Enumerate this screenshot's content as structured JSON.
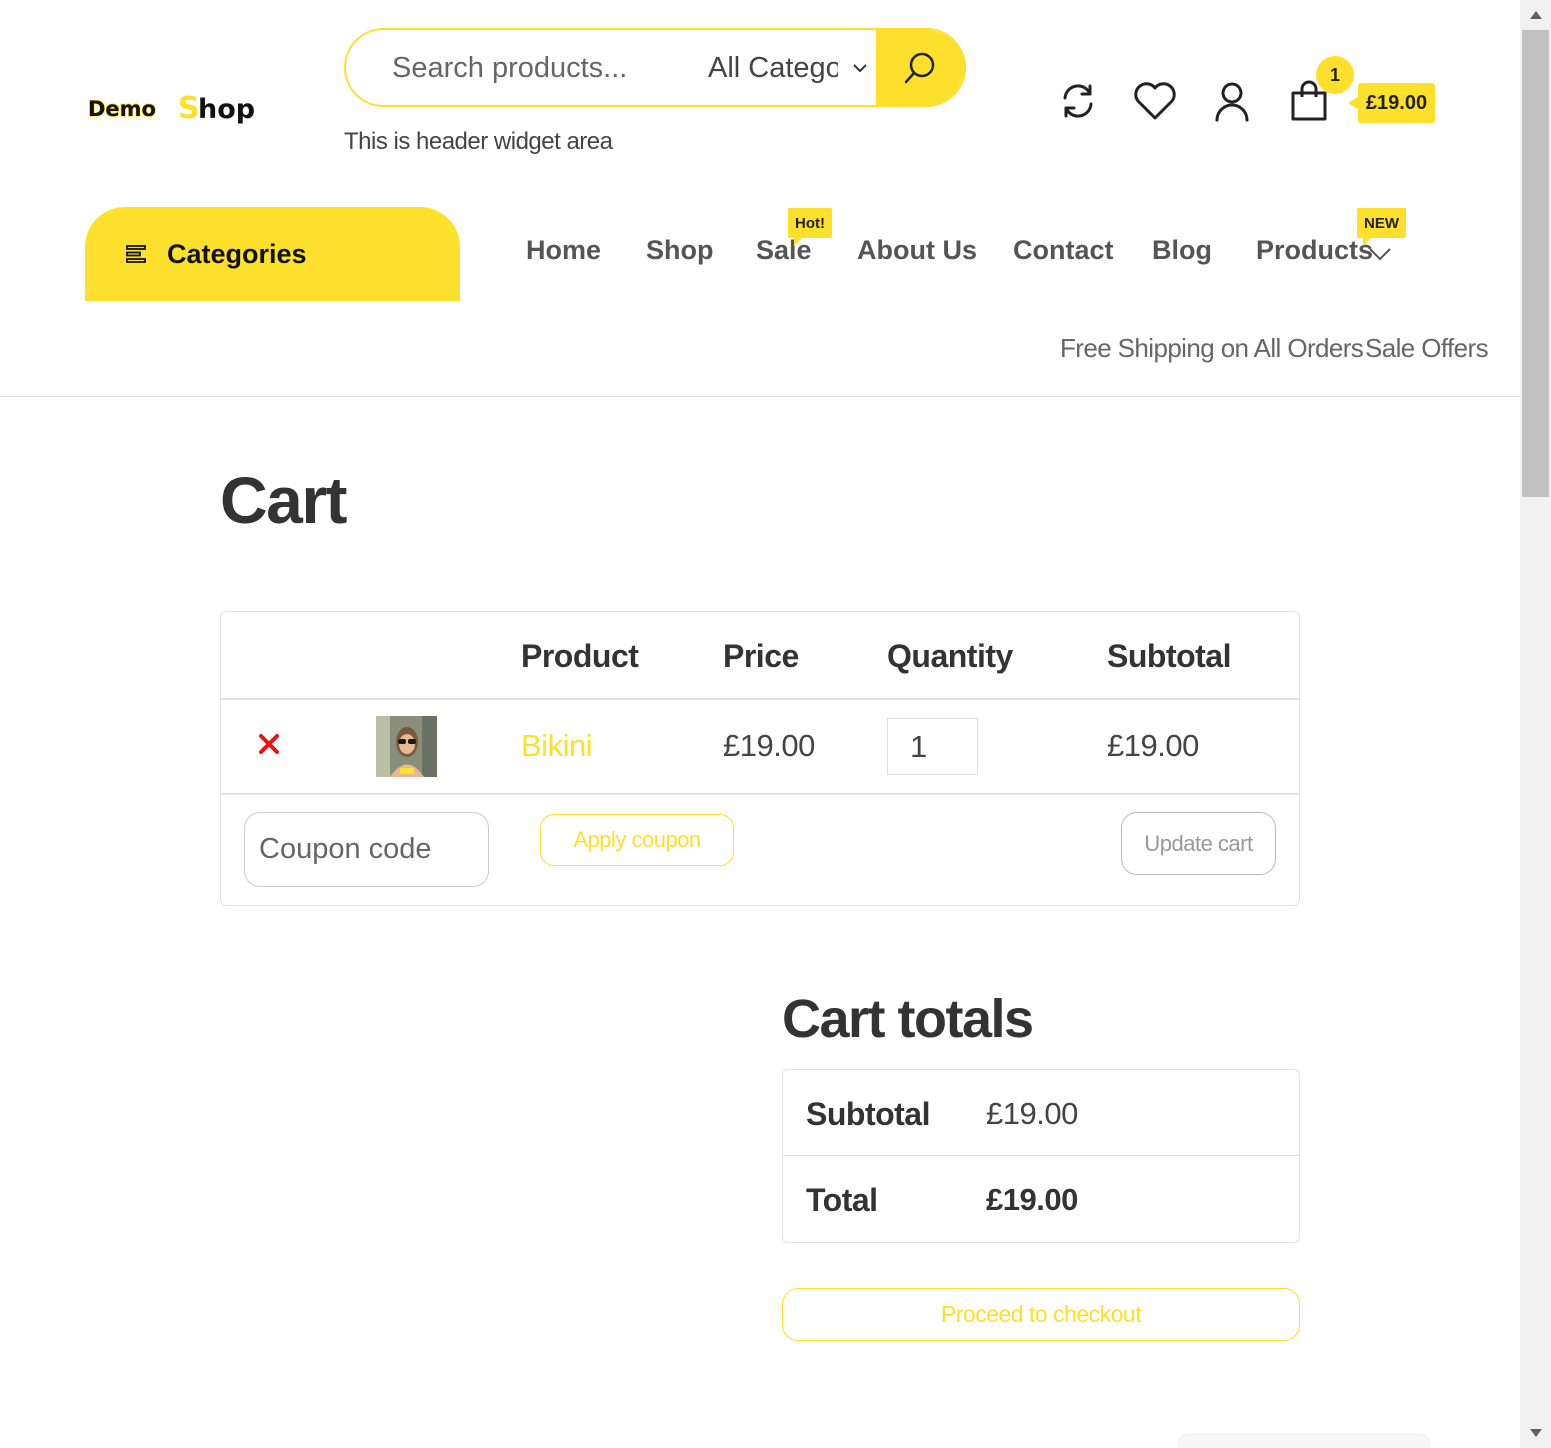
{
  "header": {
    "logo_text": "Demo Shop",
    "search": {
      "placeholder": "Search products...",
      "category": "All Categories",
      "button_icon": "search-icon"
    },
    "widget_text": "This is header widget area",
    "icons": [
      "refresh-icon",
      "heart-icon",
      "user-icon",
      "shopping-bag-icon"
    ],
    "cart_count": "1",
    "cart_total": "£19.00"
  },
  "nav": {
    "categories_label": "Categories",
    "items": [
      {
        "label": "Home"
      },
      {
        "label": "Shop"
      },
      {
        "label": "Sale",
        "badge": "Hot!"
      },
      {
        "label": "About Us"
      },
      {
        "label": "Contact"
      },
      {
        "label": "Blog"
      },
      {
        "label": "Products",
        "badge": "NEW"
      }
    ],
    "top_links": [
      "Free Shipping on All Orders",
      "Sale Offers"
    ]
  },
  "cart": {
    "title": "Cart",
    "columns": [
      "Product",
      "Price",
      "Quantity",
      "Subtotal"
    ],
    "items": [
      {
        "name": "Bikini",
        "price": "£19.00",
        "quantity": "1",
        "subtotal": "£19.00"
      }
    ],
    "coupon_placeholder": "Coupon code",
    "apply_label": "Apply coupon",
    "update_label": "Update cart"
  },
  "totals": {
    "title": "Cart totals",
    "subtotal_label": "Subtotal",
    "subtotal_value": "£19.00",
    "total_label": "Total",
    "total_value": "£19.00",
    "checkout_label": "Proceed to checkout"
  },
  "colors": {
    "accent": "#fde02b",
    "remove": "#ee1111",
    "text": "#333333"
  }
}
